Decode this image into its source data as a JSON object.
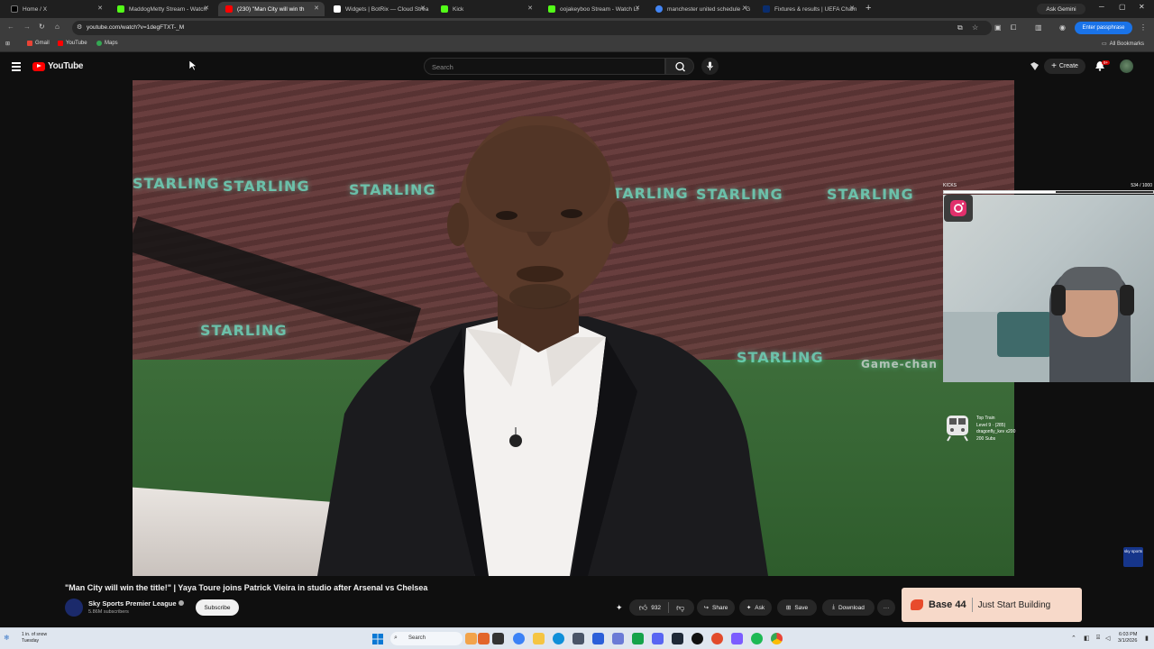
{
  "browser": {
    "tabs": [
      {
        "label": "Home / X",
        "color": "#000000"
      },
      {
        "label": "MaddogMetty Stream - Watch",
        "color": "#53fc18"
      },
      {
        "label": "(230) \"Man City will win th",
        "color": "#ff0000",
        "active": true
      },
      {
        "label": "Widgets | BotRix — Cloud Strea",
        "color": "#ffffff"
      },
      {
        "label": "Kick",
        "color": "#53fc18"
      },
      {
        "label": "oojakeyboo Stream - Watch Li",
        "color": "#53fc18"
      },
      {
        "label": "manchester united schedule - G",
        "color": "#4285f4"
      },
      {
        "label": "Fixtures & results | UEFA Cham",
        "color": "#0a2d6e"
      }
    ],
    "new_tab": "+",
    "ask_gemini": "Ask Gemini",
    "url": "youtube.com/watch?v=1degFTXT-_M",
    "passphrase": "Enter passphrase",
    "bookmarks": [
      "Gmail",
      "YouTube",
      "Maps"
    ],
    "all_bookmarks": "All Bookmarks"
  },
  "youtube": {
    "logo_text": "YouTube",
    "search_placeholder": "Search",
    "create_label": "Create",
    "notification_count": "9+"
  },
  "video": {
    "board_text": [
      "STARLING",
      "STARLING",
      "STARLING",
      "STARLING",
      "STARLING",
      "STARLING",
      "STARLING",
      "STARLING"
    ],
    "board_text_2": "Game-chan",
    "kicks_label": "KICKS",
    "kicks_count": "534 / 1000",
    "kicks_progress": 0.534,
    "top_train_lines": [
      "Top Train",
      "Level 9 · (285)",
      "dragonfly_kev x200",
      "200 Subs"
    ],
    "sky_logo": "sky sports"
  },
  "info": {
    "title": "\"Man City will win the title!\" | Yaya Toure joins Patrick Vieira in studio after Arsenal vs Chelsea",
    "channel": "Sky Sports Premier League",
    "subscribers": "5.86M subscribers",
    "subscribe_label": "Subscribe",
    "like_count": "932",
    "share_label": "Share",
    "ask_label": "Ask",
    "save_label": "Save",
    "download_label": "Download",
    "more_label": "···"
  },
  "ad": {
    "brand": "Base 44",
    "tagline": "Just Start Building"
  },
  "taskbar": {
    "weather_line1": "1 in. of snow",
    "weather_line2": "Tuesday",
    "search_label": "Search",
    "time": "6:03 PM",
    "date": "3/1/2026"
  }
}
